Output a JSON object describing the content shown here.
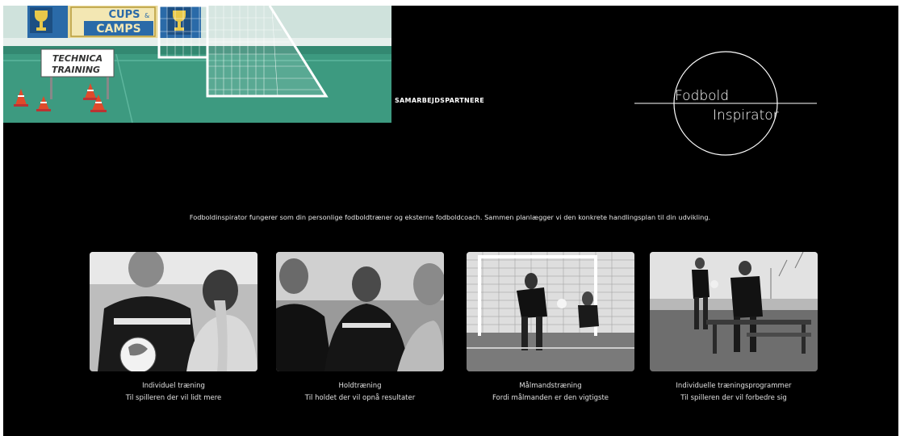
{
  "banner": {
    "sign_top_line1": "CUPS",
    "sign_top_line2": "CAMPS",
    "training_sign_line1": "TECHNICA",
    "training_sign_line2": "TRAINING"
  },
  "nav": {
    "partners_label": "SAMARBEJDSPARTNERE"
  },
  "logo": {
    "line1": "Fodbold",
    "line2": "Inspirator"
  },
  "intro_text": "Fodboldinspirator fungerer som din personlige fodboldtræner og eksterne fodboldcoach. Sammen planlægger vi den konkrete handlingsplan til din udvikling.",
  "cards": [
    {
      "title": "Individuel træning",
      "subtitle": "Til spilleren der vil lidt mere"
    },
    {
      "title": "Holdtræning",
      "subtitle": "Til holdet der vil opnå resultater"
    },
    {
      "title": "Målmandstræning",
      "subtitle": "Fordi målmanden er den vigtigste"
    },
    {
      "title": "Individuelle træningsprogrammer",
      "subtitle": "Til spilleren der vil forbedre sig"
    }
  ],
  "colors": {
    "page_background": "#000000",
    "banner_green": "#3d9a80",
    "banner_sign_blue": "#2a6aa8",
    "text": "#e6e6e6"
  }
}
